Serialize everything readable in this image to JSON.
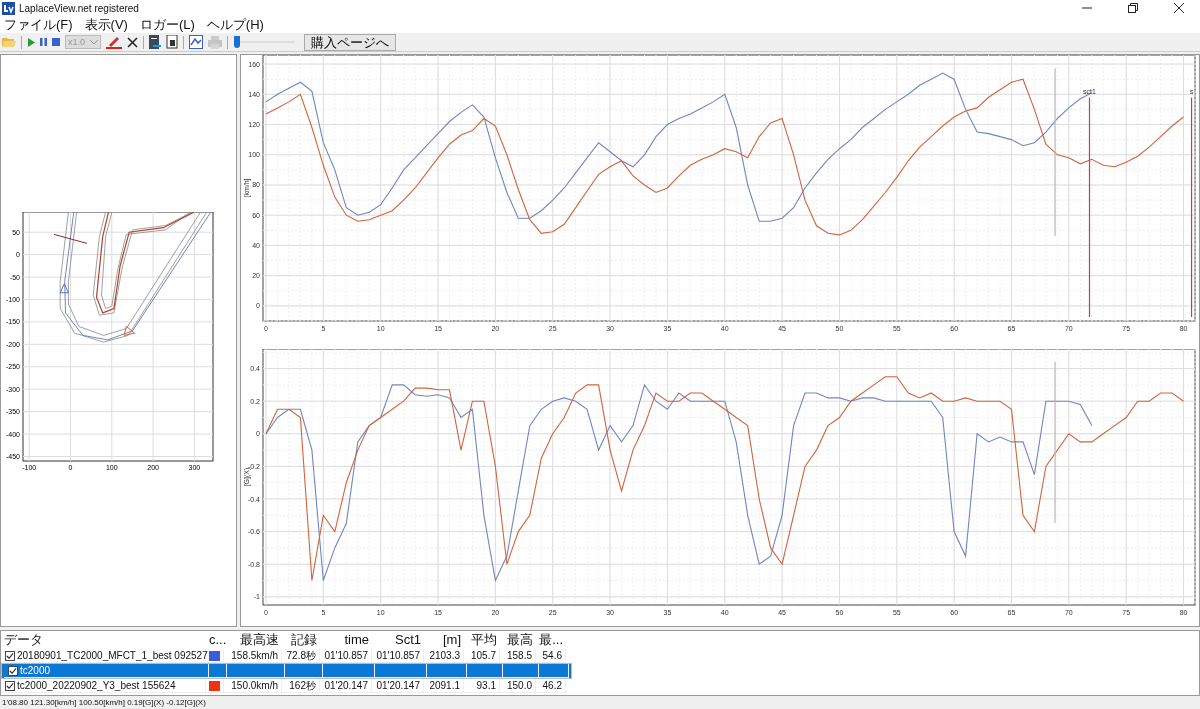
{
  "window": {
    "title": "LaplaceView.net registered"
  },
  "menu": [
    "ファイル(F)",
    "表示(V)",
    "ロガー(L)",
    "ヘルプ(H)"
  ],
  "toolbar": {
    "speed_select": {
      "value": "x1.0",
      "disabled": true
    },
    "print_disabled": true,
    "position_slider": {
      "level": 0.02
    },
    "buy_button": "購入ページへ"
  },
  "track_map": {
    "xticks": [
      "-100",
      "0",
      "100",
      "200",
      "300"
    ],
    "yticks": [
      "50",
      "0",
      "-50",
      "-100",
      "-150",
      "-200",
      "-250",
      "-300",
      "-350",
      "-400",
      "-450"
    ]
  },
  "speed_chart": {
    "chart_data": {
      "type": "line",
      "ylabel": "[km/h]",
      "xlim": [
        0,
        81
      ],
      "ylim": [
        -10,
        166
      ],
      "xticks": [
        0,
        5,
        10,
        15,
        20,
        25,
        30,
        35,
        40,
        45,
        50,
        55,
        60,
        65,
        70,
        75,
        80
      ],
      "yticks": [
        0,
        20,
        40,
        60,
        80,
        100,
        120,
        140,
        160
      ],
      "x": [
        0,
        1,
        2,
        3,
        4,
        5,
        6,
        7,
        8,
        9,
        10,
        11,
        12,
        13,
        14,
        15,
        16,
        17,
        18,
        19,
        20,
        21,
        22,
        23,
        24,
        25,
        26,
        27,
        28,
        29,
        30,
        31,
        32,
        33,
        34,
        35,
        36,
        37,
        38,
        39,
        40,
        41,
        42,
        43,
        44,
        45,
        46,
        47,
        48,
        49,
        50,
        51,
        52,
        53,
        54,
        55,
        56,
        57,
        58,
        59,
        60,
        61,
        62,
        63,
        64,
        65,
        66,
        67,
        68,
        69,
        70,
        71,
        72,
        73,
        74,
        75,
        76,
        77,
        78,
        79,
        80
      ],
      "series": [
        {
          "color": "#6f86c0",
          "values": [
            135,
            140,
            144,
            148,
            142,
            108,
            90,
            65,
            60,
            62,
            67,
            78,
            90,
            98,
            106,
            114,
            122,
            128,
            133,
            125,
            98,
            75,
            58,
            58,
            63,
            70,
            78,
            88,
            98,
            108,
            102,
            96,
            92,
            100,
            112,
            120,
            124,
            127,
            131,
            135,
            140,
            118,
            80,
            56,
            56,
            58,
            65,
            78,
            88,
            97,
            104,
            110,
            118,
            124,
            130,
            135,
            140,
            146,
            150,
            154,
            150,
            130,
            115,
            114,
            112,
            110,
            106,
            108,
            115,
            124,
            131,
            137,
            141,
            null,
            null,
            null,
            null,
            null,
            null,
            null,
            null
          ]
        },
        {
          "color": "#d0643c",
          "values": [
            127,
            131,
            135,
            140,
            118,
            93,
            72,
            60,
            56,
            57,
            60,
            63,
            70,
            78,
            88,
            98,
            107,
            113,
            116,
            124,
            119,
            100,
            77,
            57,
            48,
            49,
            54,
            65,
            76,
            87,
            92,
            96,
            86,
            80,
            75,
            78,
            86,
            93,
            97,
            100,
            104,
            102,
            98,
            112,
            121,
            124,
            100,
            70,
            53,
            48,
            47,
            50,
            57,
            66,
            75,
            85,
            96,
            105,
            112,
            119,
            125,
            129,
            131,
            138,
            143,
            148,
            150,
            130,
            107,
            100,
            98,
            94,
            97,
            93,
            92,
            95,
            99,
            105,
            112,
            119,
            125
          ]
        }
      ],
      "grid": true,
      "ref_lines": [
        {
          "axis": "x",
          "value": 68.8
        },
        {
          "axis": "x",
          "value": 71.8,
          "label": "sct1"
        },
        {
          "axis": "x",
          "value": 80.7,
          "label": "s"
        }
      ]
    }
  },
  "g_chart": {
    "chart_data": {
      "type": "line",
      "ylabel": "[G](X)",
      "xlim": [
        0,
        81
      ],
      "ylim": [
        -1.05,
        0.52
      ],
      "xticks": [
        0,
        5,
        10,
        15,
        20,
        25,
        30,
        35,
        40,
        45,
        50,
        55,
        60,
        65,
        70,
        75,
        80
      ],
      "yticks": [
        -1,
        -0.8,
        -0.6,
        -0.4,
        -0.2,
        0,
        0.2,
        0.4
      ],
      "x": [
        0,
        1,
        2,
        3,
        4,
        5,
        6,
        7,
        8,
        9,
        10,
        11,
        12,
        13,
        14,
        15,
        16,
        17,
        18,
        19,
        20,
        21,
        22,
        23,
        24,
        25,
        26,
        27,
        28,
        29,
        30,
        31,
        32,
        33,
        34,
        35,
        36,
        37,
        38,
        39,
        40,
        41,
        42,
        43,
        44,
        45,
        46,
        47,
        48,
        49,
        50,
        51,
        52,
        53,
        54,
        55,
        56,
        57,
        58,
        59,
        60,
        61,
        62,
        63,
        64,
        65,
        66,
        67,
        68,
        69,
        70,
        71,
        72,
        73,
        74,
        75,
        76,
        77,
        78,
        79,
        80
      ],
      "series": [
        {
          "color": "#6f86c0",
          "values": [
            0,
            0.1,
            0.15,
            0.15,
            -0.1,
            -0.9,
            -0.7,
            -0.55,
            -0.05,
            0.05,
            0.1,
            0.3,
            0.3,
            0.24,
            0.23,
            0.24,
            0.22,
            0.1,
            0.15,
            -0.5,
            -0.9,
            -0.75,
            -0.35,
            0.05,
            0.15,
            0.2,
            0.22,
            0.2,
            0.15,
            -0.1,
            0.05,
            -0.05,
            0.05,
            0.3,
            0.2,
            0.15,
            0.25,
            0.2,
            0.2,
            0.2,
            0.2,
            -0.05,
            -0.5,
            -0.8,
            -0.75,
            -0.5,
            0.05,
            0.25,
            0.25,
            0.22,
            0.22,
            0.2,
            0.22,
            0.22,
            0.2,
            0.2,
            0.2,
            0.2,
            0.2,
            0.1,
            -0.6,
            -0.75,
            0,
            -0.05,
            -0.02,
            -0.05,
            -0.05,
            -0.25,
            0.2,
            0.2,
            0.2,
            0.18,
            0.05,
            null,
            null,
            null,
            null,
            null,
            null,
            null,
            null
          ]
        },
        {
          "color": "#d0643c",
          "values": [
            0,
            0.15,
            0.15,
            0.1,
            -0.9,
            -0.5,
            -0.6,
            -0.3,
            -0.1,
            0.05,
            0.1,
            0.15,
            0.2,
            0.28,
            0.28,
            0.27,
            0.27,
            -0.1,
            0.2,
            0.2,
            -0.2,
            -0.8,
            -0.6,
            -0.5,
            -0.15,
            0,
            0.1,
            0.25,
            0.3,
            0.3,
            -0.1,
            -0.35,
            -0.1,
            0.05,
            0.25,
            0.2,
            0.2,
            0.25,
            0.25,
            0.2,
            0.15,
            0.1,
            0.05,
            -0.4,
            -0.7,
            -0.8,
            -0.5,
            -0.2,
            -0.1,
            0.05,
            0.1,
            0.2,
            0.25,
            0.3,
            0.35,
            0.35,
            0.25,
            0.22,
            0.25,
            0.2,
            0.2,
            0.22,
            0.2,
            0.2,
            0.2,
            0.15,
            -0.5,
            -0.6,
            -0.2,
            -0.1,
            0,
            -0.05,
            -0.05,
            0,
            0.05,
            0.1,
            0.2,
            0.2,
            0.25,
            0.25,
            0.2
          ]
        }
      ],
      "grid": true,
      "ref_lines": [
        {
          "axis": "x",
          "value": 68.8
        }
      ]
    }
  },
  "table": {
    "columns": [
      "データ",
      "c...",
      "最高速",
      "記録",
      "time",
      "Sct1",
      "[m]",
      "平均",
      "最高",
      "最..."
    ],
    "rows": [
      {
        "checked": true,
        "selected": false,
        "color": "#3b5bdb",
        "cells": [
          "20180901_TC2000_MFCT_1_best 092527",
          "",
          "158.5km/h",
          "72.8秒",
          "01'10.857",
          "01'10.857",
          "2103.3",
          "105.7",
          "158.5",
          "54.6"
        ]
      },
      {
        "checked": true,
        "selected": true,
        "cells": [
          "tc2000"
        ]
      },
      {
        "checked": true,
        "selected": false,
        "color": "#ee3311",
        "cells": [
          "tc2000_20220902_Y3_best 155624",
          "",
          "150.0km/h",
          "162秒",
          "01'20.147",
          "01'20.147",
          "2091.1",
          "93.1",
          "150.0",
          "46.2"
        ]
      }
    ]
  },
  "status_bar": "1'08.80 121.30[km/h] 100.50[km/h]  0.19[G](X) -0.12[G](X)"
}
